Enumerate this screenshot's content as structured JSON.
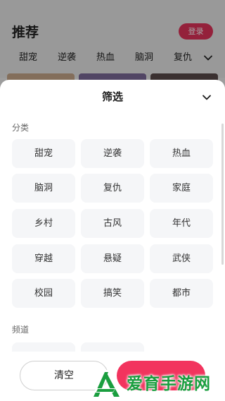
{
  "background": {
    "title": "推荐",
    "login_label": "登录",
    "tabs": [
      "甜宠",
      "逆袭",
      "热血",
      "脑洞",
      "复仇"
    ],
    "tabs_more_icon": "chevron-down-icon"
  },
  "sheet": {
    "title": "筛选",
    "close_icon": "chevron-down-icon",
    "category_label": "分类",
    "categories": [
      "甜宠",
      "逆袭",
      "热血",
      "脑洞",
      "复仇",
      "家庭",
      "乡村",
      "古风",
      "年代",
      "穿越",
      "悬疑",
      "武侠",
      "校园",
      "搞笑",
      "都市"
    ],
    "channel_label": "频道",
    "clear_label": "清空",
    "confirm_label": ""
  },
  "watermark": {
    "text": "爱育手游网"
  },
  "colors": {
    "accent": "#f2345e",
    "chip_bg": "#f5f6f8",
    "watermark_green": "#1a9e3f"
  }
}
